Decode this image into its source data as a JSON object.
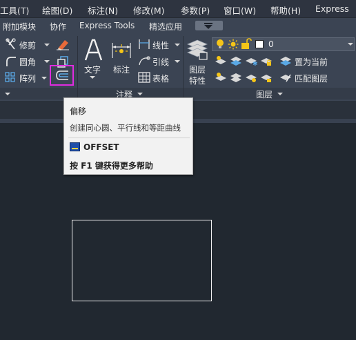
{
  "menubar": {
    "items": [
      "工具(T)",
      "绘图(D)",
      "标注(N)",
      "修改(M)",
      "参数(P)",
      "窗口(W)",
      "帮助(H)",
      "Express"
    ]
  },
  "ribbon_tabs": [
    "附加模块",
    "协作",
    "Express Tools",
    "精选应用"
  ],
  "modify_panel": {
    "trim_label": "修剪",
    "fillet_label": "圆角",
    "array_label": "阵列"
  },
  "annotation_panel": {
    "text_label": "文字",
    "dimension_label": "标注",
    "linear_label": "线性",
    "leader_label": "引线",
    "table_label": "表格",
    "footer": "注释"
  },
  "layers_panel": {
    "layer_properties_line1": "图层",
    "layer_properties_line2": "特性",
    "current_layer": "0",
    "set_current_label": "置为当前",
    "match_layer_label": "匹配图层",
    "footer": "图层"
  },
  "tooltip": {
    "title": "偏移",
    "description": "创建同心圆、平行线和等距曲线",
    "command": "OFFSET",
    "help": "按 F1 键获得更多帮助"
  },
  "colors": {
    "highlight": "#e02ce0",
    "canvas": "#212830",
    "ribbon": "#3b4453",
    "lightbulb": "#f5c518"
  }
}
